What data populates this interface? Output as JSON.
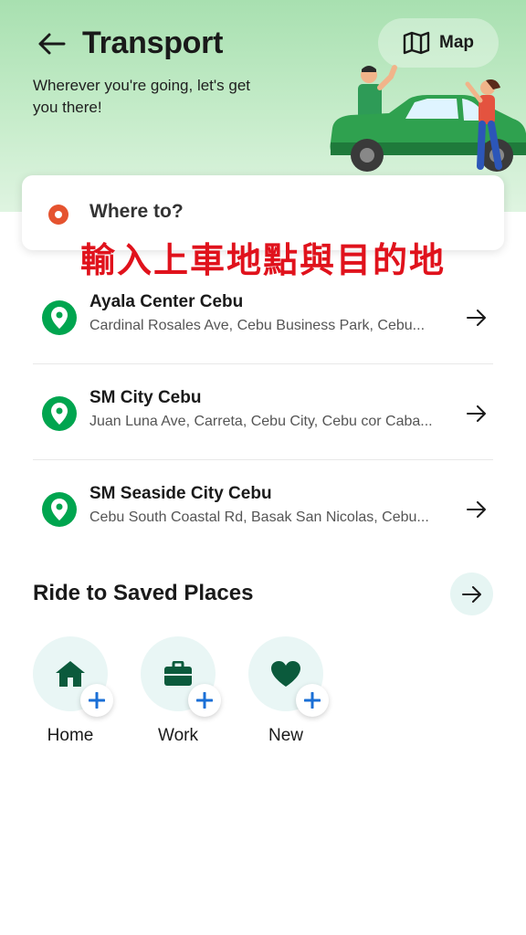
{
  "header": {
    "title": "Transport",
    "subtitle": "Wherever you're going, let's get you there!",
    "map_label": "Map"
  },
  "search": {
    "label": "Where to?"
  },
  "overlay_caption": "輸入上車地點與目的地",
  "places": [
    {
      "name": "Ayala Center Cebu",
      "address": "Cardinal Rosales Ave, Cebu Business Park, Cebu..."
    },
    {
      "name": "SM City Cebu",
      "address": "Juan Luna Ave, Carreta, Cebu City, Cebu cor Caba..."
    },
    {
      "name": "SM Seaside City Cebu",
      "address": "Cebu South Coastal Rd, Basak San Nicolas, Cebu..."
    }
  ],
  "saved_places": {
    "title": "Ride to Saved Places",
    "items": [
      {
        "label": "Home",
        "icon": "home-icon"
      },
      {
        "label": "Work",
        "icon": "briefcase-icon"
      },
      {
        "label": "New",
        "icon": "heart-icon"
      }
    ]
  },
  "colors": {
    "brand_green": "#00a54f",
    "dark_green": "#0b5a3c",
    "accent_blue": "#1a6fd6",
    "origin_dot": "#e5532f",
    "caption_red": "#e0121c"
  }
}
